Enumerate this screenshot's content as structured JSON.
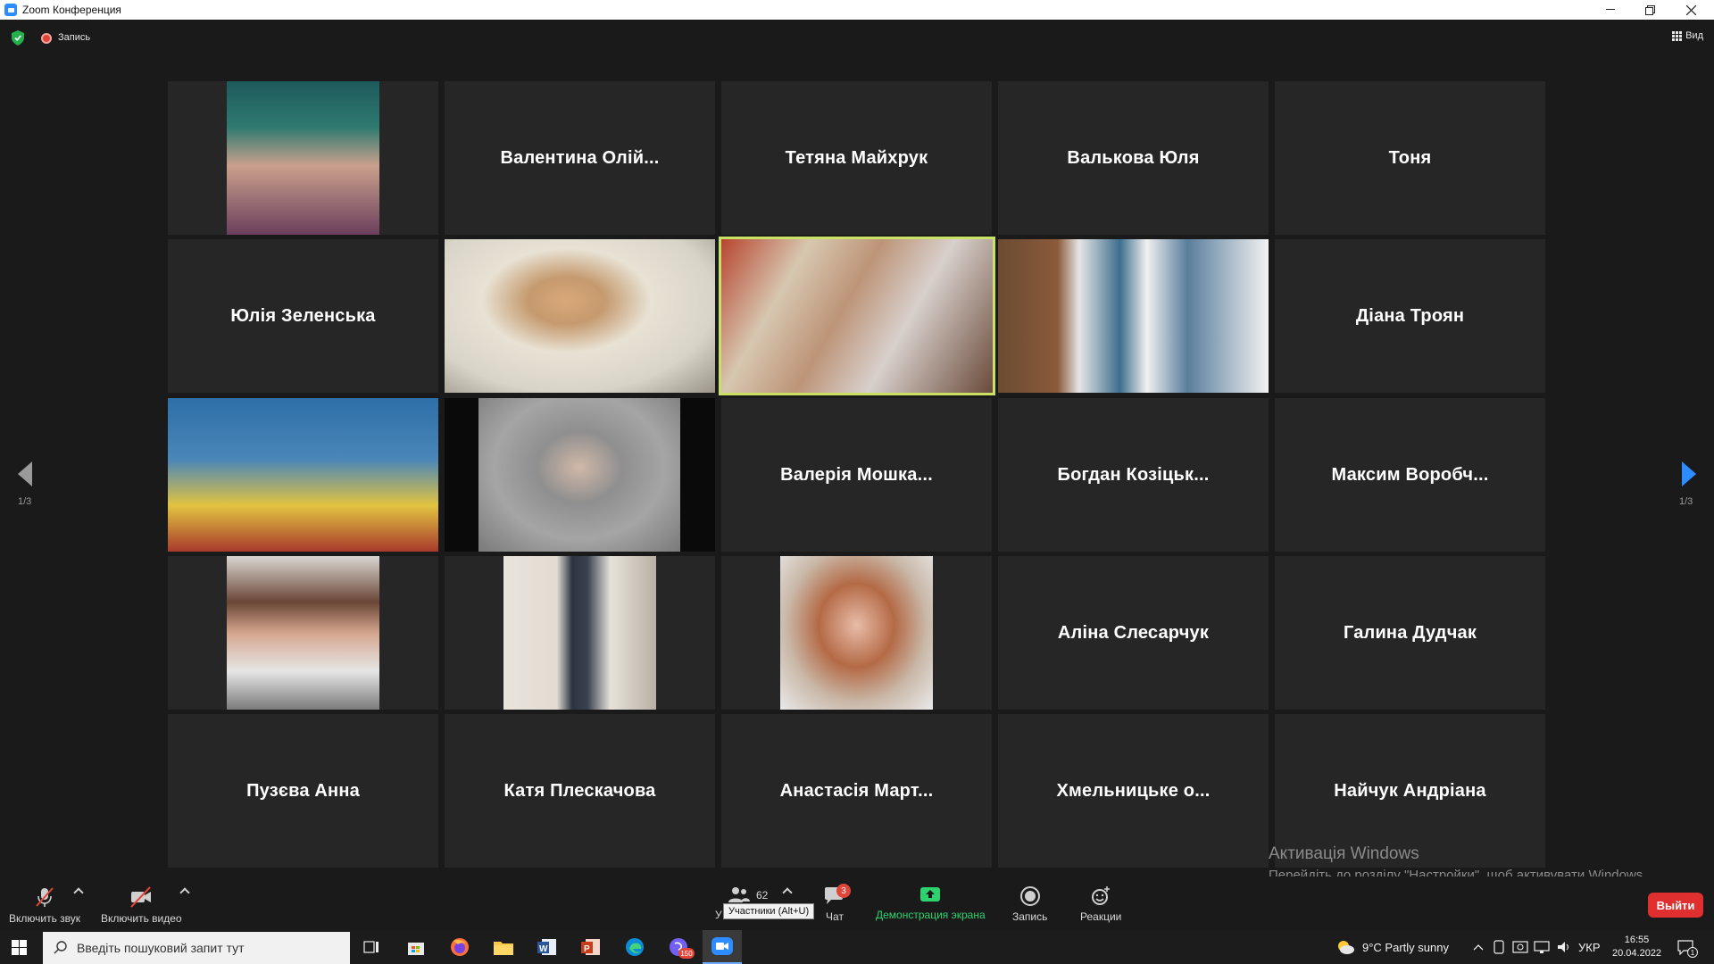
{
  "window": {
    "title": "Zoom Конференция"
  },
  "topbar": {
    "recording_label": "Запись",
    "view_label": "Вид"
  },
  "participants": [
    {
      "name": "",
      "video": "woman-dark-hair-teal"
    },
    {
      "name": "Валентина  Олій..."
    },
    {
      "name": "Тетяна Майхрук"
    },
    {
      "name": "Валькова Юля"
    },
    {
      "name": "Тоня"
    },
    {
      "name": "Юлія Зеленська"
    },
    {
      "name": "",
      "video": "woman-glasses-waving"
    },
    {
      "name": "",
      "video": "man-library-active"
    },
    {
      "name": "",
      "video": "library-room"
    },
    {
      "name": "Діана Троян"
    },
    {
      "name": "",
      "video": "woman-flag"
    },
    {
      "name": "",
      "video": "woman-glasses-grey"
    },
    {
      "name": "Валерія  Мошка..."
    },
    {
      "name": "Богдан  Козіцьк..."
    },
    {
      "name": "Максим  Воробч..."
    },
    {
      "name": "",
      "video": "girl-curly"
    },
    {
      "name": "",
      "video": "man-mirror"
    },
    {
      "name": "",
      "video": "girl-red-hair"
    },
    {
      "name": "Аліна Слесарчук"
    },
    {
      "name": "Галина Дудчак"
    },
    {
      "name": "Пузєва Анна"
    },
    {
      "name": "Катя Плескачова"
    },
    {
      "name": "Анастасія  Март..."
    },
    {
      "name": "Хмельницьке  о..."
    },
    {
      "name": "Найчук Андріана"
    }
  ],
  "pagination": {
    "left": "1/3",
    "right": "1/3"
  },
  "watermark": {
    "line1": "Активація Windows",
    "line2": "Перейдіть до розділу \"Настройки\", щоб активувати Windows."
  },
  "toolbar": {
    "mic_label": "Включить звук",
    "video_label": "Включить видео",
    "participants_count": "62",
    "participants_label_partial": "У",
    "participants_tooltip": "Участники (Alt+U)",
    "chat_label": "Чат",
    "chat_badge": "3",
    "share_label": "Демонстрация экрана",
    "record_label": "Запись",
    "reactions_label": "Реакции",
    "leave_label": "Выйти"
  },
  "taskbar": {
    "search_placeholder": "Введіть пошуковий запит тут",
    "viber_badge": "150",
    "weather": "9°C  Partly sunny",
    "language": "УКР",
    "time": "16:55",
    "date": "20.04.2022",
    "notification_count": "1"
  },
  "colors": {
    "active_speaker": "#c9e164",
    "share_green": "#2dd36f",
    "leave_red": "#e02f2f",
    "zoom_blue": "#2d8cff"
  }
}
